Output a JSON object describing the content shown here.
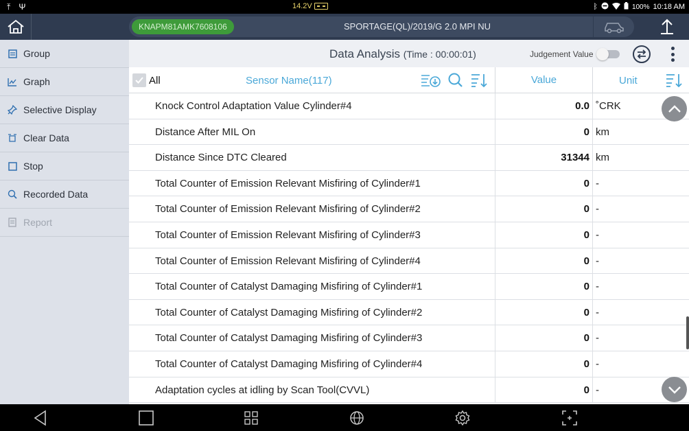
{
  "status_bar": {
    "left_icons": [
      "upload-icon",
      "usb-icon"
    ],
    "voltage": "14.2V",
    "battery_percent": "100%",
    "time": "10:18 AM",
    "right_icons": [
      "bluetooth-icon",
      "dnd-icon",
      "wifi-icon",
      "battery-icon"
    ]
  },
  "header": {
    "vin": "KNAPM81AMK7608106",
    "vehicle": "SPORTAGE(QL)/2019/G 2.0 MPI NU"
  },
  "sidebar": {
    "items": [
      {
        "label": "Group",
        "icon": "group-icon",
        "enabled": true
      },
      {
        "label": "Graph",
        "icon": "graph-icon",
        "enabled": true
      },
      {
        "label": "Selective Display",
        "icon": "pin-icon",
        "enabled": true
      },
      {
        "label": "Clear Data",
        "icon": "clear-icon",
        "enabled": true
      },
      {
        "label": "Stop",
        "icon": "stop-icon",
        "enabled": true
      },
      {
        "label": "Recorded Data",
        "icon": "recorded-icon",
        "enabled": true
      },
      {
        "label": "Report",
        "icon": "report-icon",
        "enabled": false
      }
    ]
  },
  "main": {
    "title": "Data Analysis",
    "time_label": "(Time : 00:00:01)",
    "judgement_label": "Judgement Value",
    "judgement_on": false,
    "columns": {
      "all": "All",
      "sensor": "Sensor Name(117)",
      "value": "Value",
      "unit": "Unit"
    },
    "rows": [
      {
        "name": "Knock Control Adaptation Value Cylinder#4",
        "value": "0.0",
        "unit": "˚CRK"
      },
      {
        "name": "Distance After MIL On",
        "value": "0",
        "unit": "km"
      },
      {
        "name": "Distance Since DTC Cleared",
        "value": "31344",
        "unit": "km"
      },
      {
        "name": "Total Counter of Emission Relevant Misfiring of Cylinder#1",
        "value": "0",
        "unit": "-"
      },
      {
        "name": "Total Counter of Emission Relevant Misfiring of Cylinder#2",
        "value": "0",
        "unit": "-"
      },
      {
        "name": "Total Counter of Emission Relevant Misfiring of Cylinder#3",
        "value": "0",
        "unit": "-"
      },
      {
        "name": "Total Counter of Emission Relevant Misfiring of Cylinder#4",
        "value": "0",
        "unit": "-"
      },
      {
        "name": "Total Counter of Catalyst Damaging Misfiring of Cylinder#1",
        "value": "0",
        "unit": "-"
      },
      {
        "name": "Total Counter of Catalyst Damaging Misfiring of Cylinder#2",
        "value": "0",
        "unit": "-"
      },
      {
        "name": "Total Counter of Catalyst Damaging Misfiring of Cylinder#3",
        "value": "0",
        "unit": "-"
      },
      {
        "name": "Total Counter of Catalyst Damaging Misfiring of Cylinder#4",
        "value": "0",
        "unit": "-"
      },
      {
        "name": "Adaptation cycles at idling by Scan Tool(CVVL)",
        "value": "0",
        "unit": "-"
      }
    ]
  },
  "nav_bar": {
    "buttons": [
      "back-icon",
      "recent-apps-icon",
      "apps-grid-icon",
      "globe-icon",
      "settings-icon",
      "screenshot-icon"
    ]
  },
  "colors": {
    "header_bg": "#2f3b50",
    "sidebar_bg": "#dde1e9",
    "vin_pill": "#3e9b3a",
    "accent_blue": "#4aa8d8",
    "voltage_yellow": "#e8d36a"
  }
}
